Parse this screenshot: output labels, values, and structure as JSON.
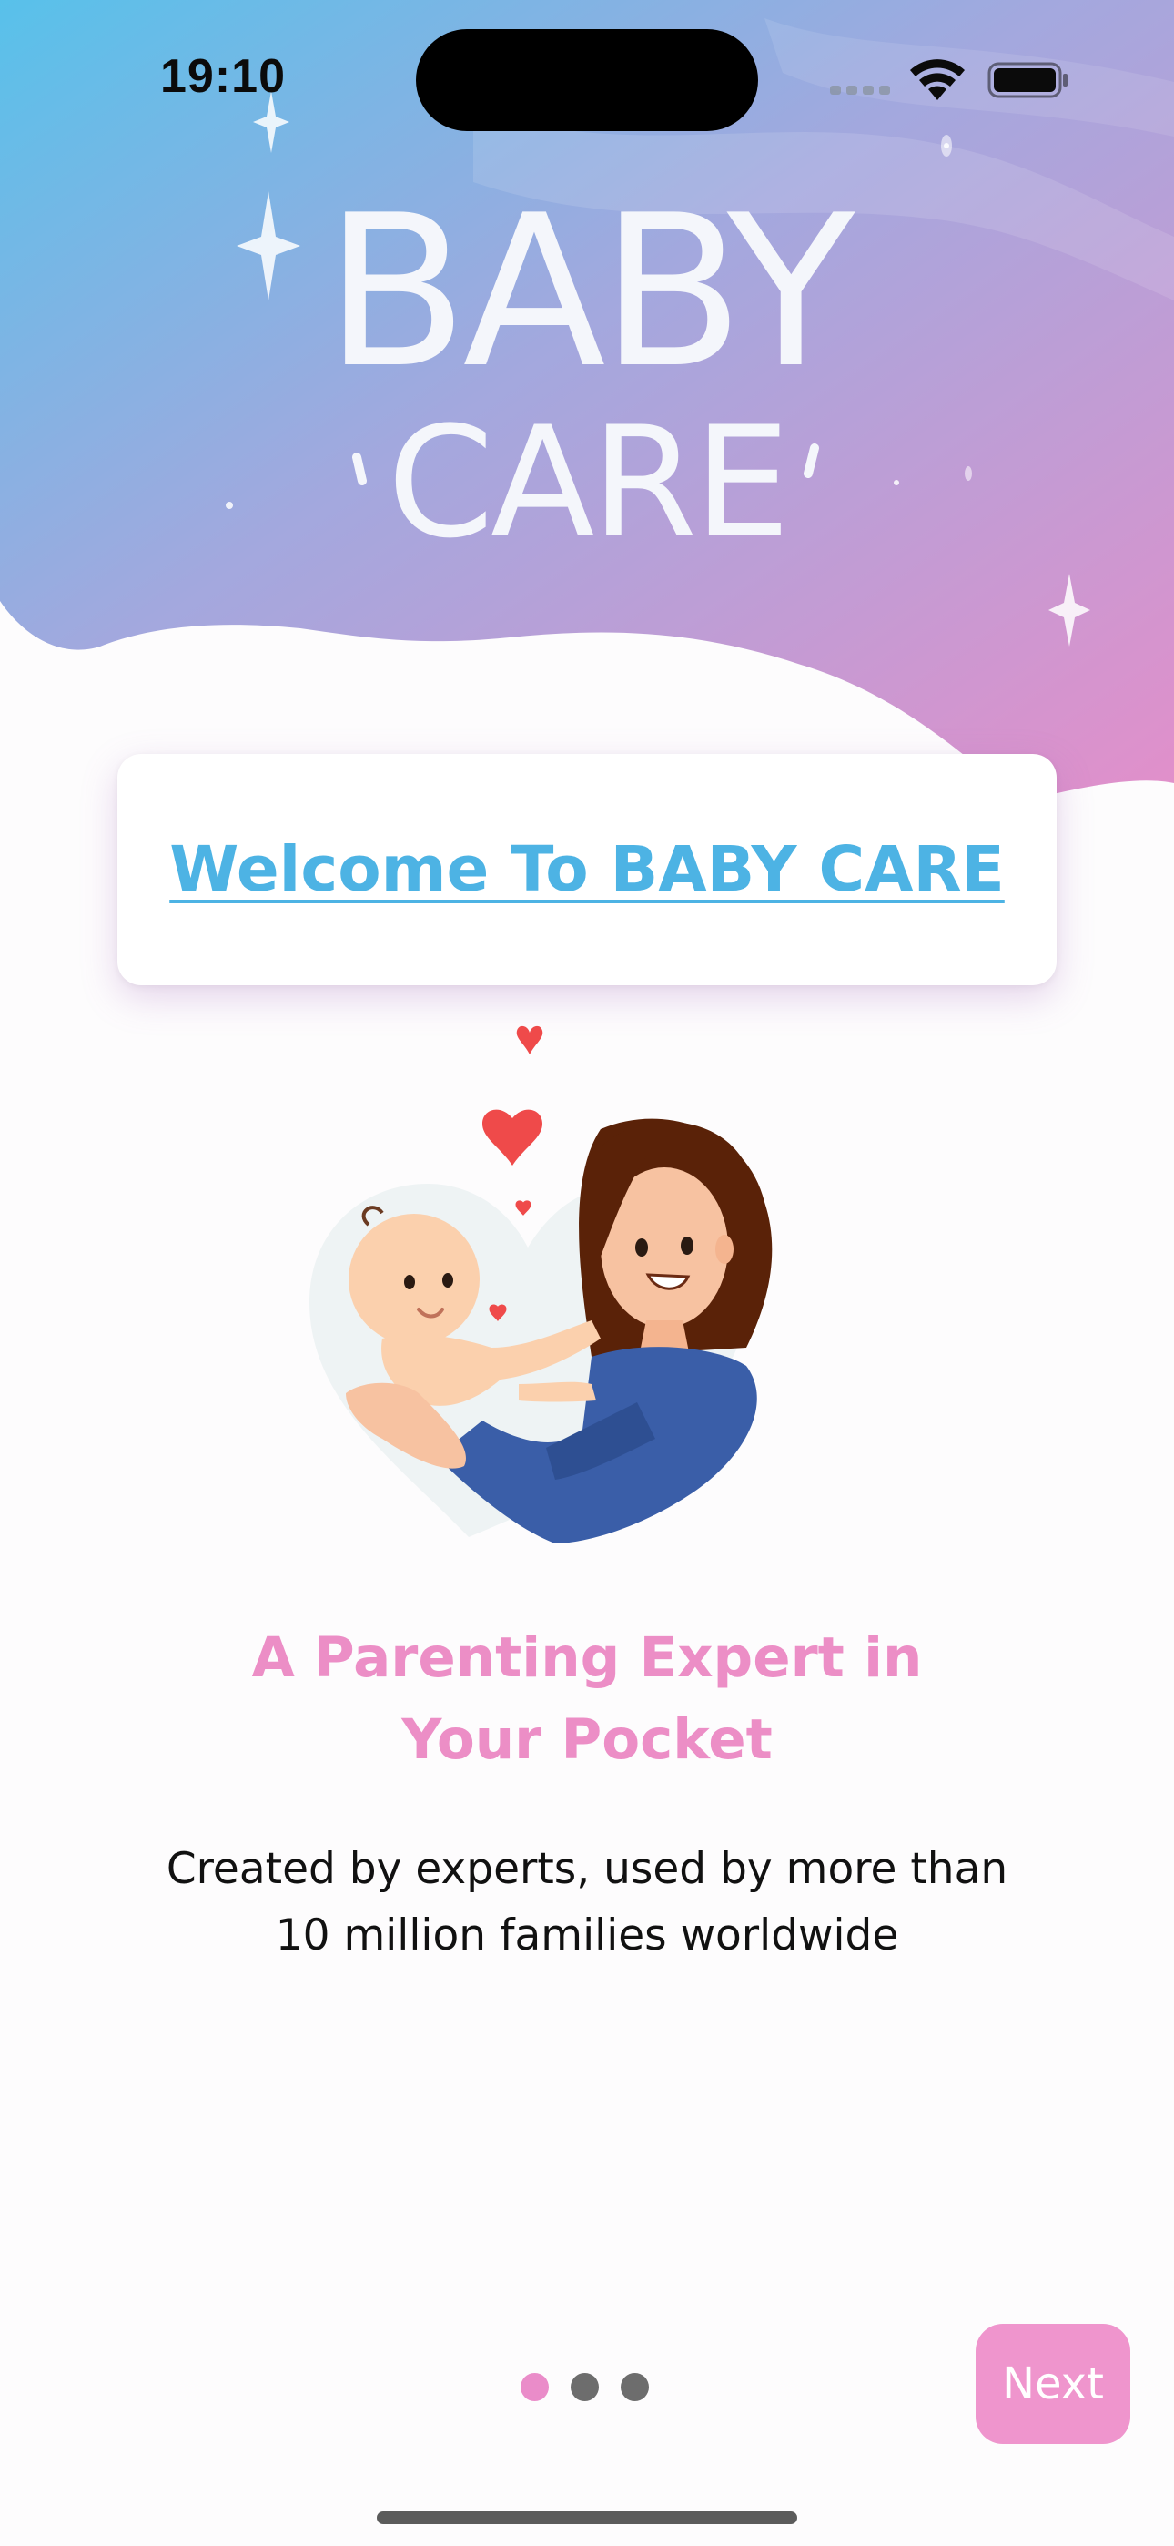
{
  "status_bar": {
    "time": "19:10"
  },
  "logo": {
    "line1": "BABY",
    "line2": "CARE"
  },
  "welcome": {
    "title": "Welcome To BABY CARE"
  },
  "headline": {
    "line1": "A Parenting Expert in",
    "line2": "Your Pocket"
  },
  "subtext": {
    "line1": "Created by experts, used by more than",
    "line2": "10 million families worldwide"
  },
  "pagination": {
    "total": 3,
    "active": 1
  },
  "next_button": {
    "label": "Next"
  },
  "colors": {
    "accent_blue": "#4db3e4",
    "accent_pink": "#ec8ec6",
    "hero_gradient_start": "#5bbde9",
    "hero_gradient_end": "#e190cc"
  }
}
